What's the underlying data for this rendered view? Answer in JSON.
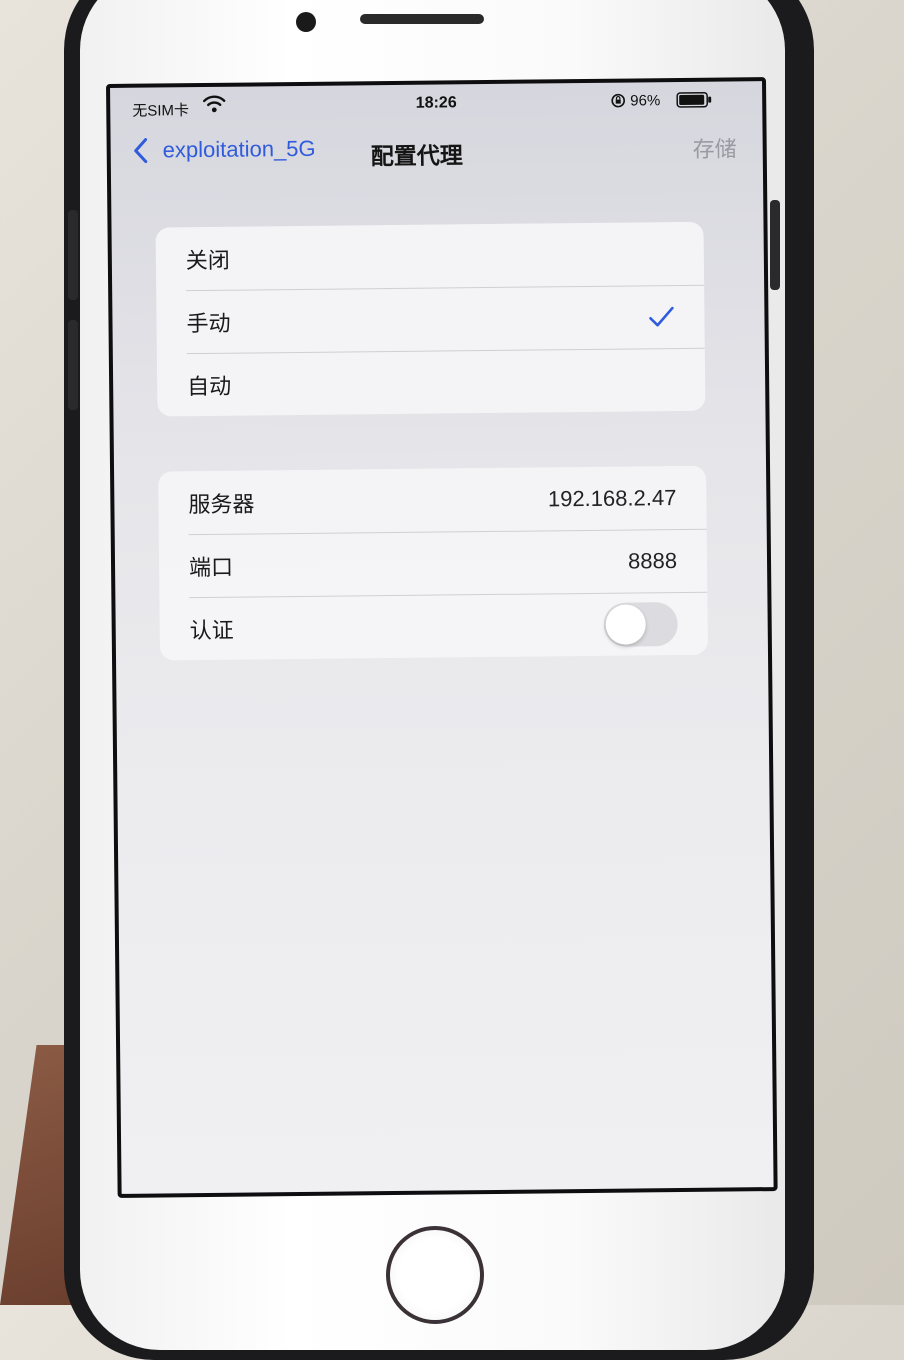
{
  "status_bar": {
    "carrier": "无SIM卡",
    "time": "18:26",
    "battery_percent": "96%",
    "battery_level": 0.96
  },
  "nav": {
    "back_label": "exploitation_5G",
    "title": "配置代理",
    "save_label": "存储"
  },
  "proxy_mode": {
    "options": [
      "关闭",
      "手动",
      "自动"
    ],
    "selected": "手动"
  },
  "proxy_settings": {
    "server_label": "服务器",
    "server_value": "192.168.2.47",
    "port_label": "端口",
    "port_value": "8888",
    "auth_label": "认证",
    "auth_enabled": false
  },
  "colors": {
    "accent": "#2f5bdc",
    "disabled_text": "#9a9aa2",
    "toggle_off": "#dcdce0"
  },
  "icons": [
    "wifi-icon",
    "orientation-lock-icon",
    "battery-icon",
    "chevron-left-icon",
    "checkmark-icon"
  ]
}
